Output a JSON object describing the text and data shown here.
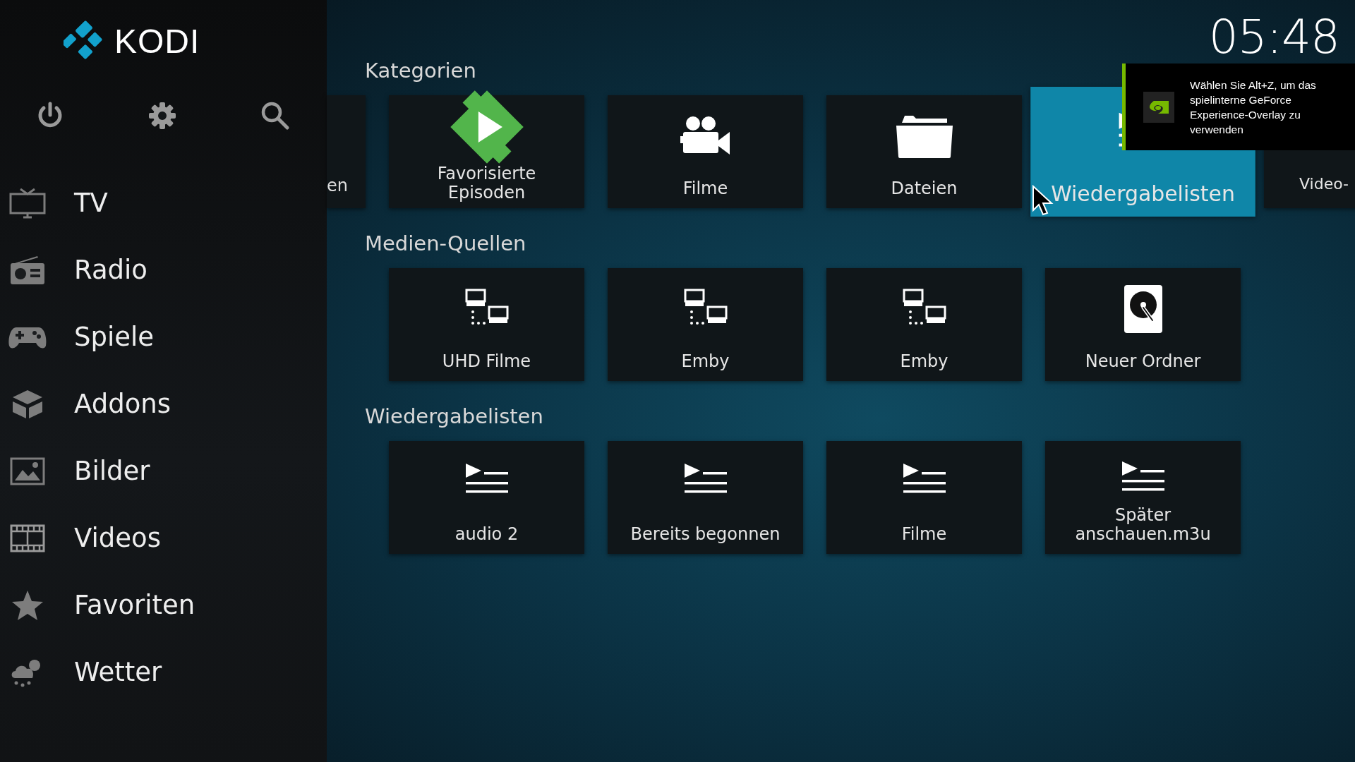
{
  "header": {
    "logo_text": "KODI",
    "clock": "05:48"
  },
  "sidebar": {
    "items": [
      {
        "label": "TV",
        "kind": "tv"
      },
      {
        "label": "Radio",
        "kind": "radio"
      },
      {
        "label": "Spiele",
        "kind": "gamepad"
      },
      {
        "label": "Addons",
        "kind": "box"
      },
      {
        "label": "Bilder",
        "kind": "picture"
      },
      {
        "label": "Videos",
        "kind": "film"
      },
      {
        "label": "Favoriten",
        "kind": "star"
      },
      {
        "label": "Wetter",
        "kind": "weather"
      }
    ]
  },
  "sections": [
    {
      "title": "Kategorien",
      "tiles": [
        {
          "kind": "clipped",
          "label": "en",
          "selected": false
        },
        {
          "kind": "emby",
          "label": "Favorisierte Episoden",
          "selected": false
        },
        {
          "kind": "camera",
          "label": "Filme",
          "selected": false
        },
        {
          "kind": "folder",
          "label": "Dateien",
          "selected": false
        },
        {
          "kind": "playlist",
          "label": "Wiedergabelisten",
          "selected": true
        },
        {
          "kind": "partial",
          "label": "Video-",
          "selected": false
        }
      ]
    },
    {
      "title": "Medien-Quellen",
      "tiles": [
        {
          "kind": "network",
          "label": "UHD Filme",
          "selected": false
        },
        {
          "kind": "network",
          "label": "Emby",
          "selected": false
        },
        {
          "kind": "network",
          "label": "Emby",
          "selected": false
        },
        {
          "kind": "disk",
          "label": "Neuer Ordner",
          "selected": false
        }
      ]
    },
    {
      "title": "Wiedergabelisten",
      "tiles": [
        {
          "kind": "playlist",
          "label": "audio 2",
          "selected": false
        },
        {
          "kind": "playlist",
          "label": "Bereits begonnen",
          "selected": false
        },
        {
          "kind": "playlist",
          "label": "Filme",
          "selected": false
        },
        {
          "kind": "playlist",
          "label": "Später anschauen.m3u",
          "selected": false
        }
      ]
    }
  ],
  "notification": {
    "text": "Wählen Sie Alt+Z, um das spielinterne GeForce Experience-Overlay zu verwenden"
  }
}
